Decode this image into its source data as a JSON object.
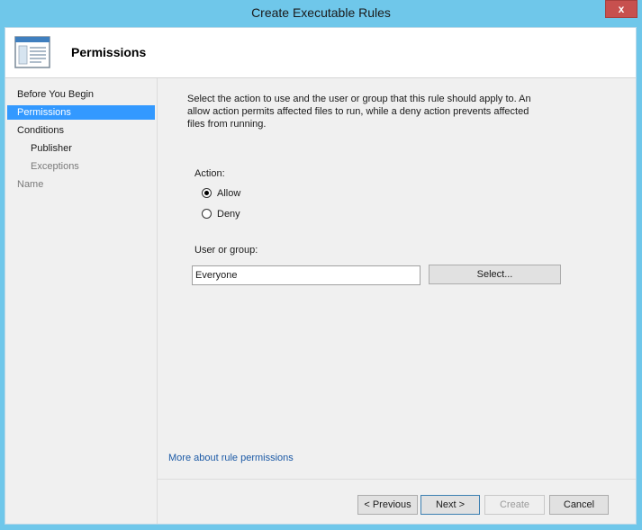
{
  "window": {
    "title": "Create Executable Rules",
    "close_glyph": "x"
  },
  "header": {
    "title": "Permissions",
    "icon": "wizard-page-icon"
  },
  "nav": {
    "items": [
      {
        "label": "Before You Begin",
        "state": "normal"
      },
      {
        "label": "Permissions",
        "state": "active"
      },
      {
        "label": "Conditions",
        "state": "normal"
      },
      {
        "label": "Publisher",
        "state": "normal"
      },
      {
        "label": "Exceptions",
        "state": "dim"
      },
      {
        "label": "Name",
        "state": "dim"
      }
    ]
  },
  "content": {
    "description": "Select the action to use and the user or group that this rule should apply to. An allow action permits affected files to run, while a deny action prevents affected files from running.",
    "action_label": "Action:",
    "allow_label": "Allow",
    "deny_label": "Deny",
    "selected_action": "Allow",
    "user_group_label": "User or group:",
    "user_group_value": "Everyone",
    "select_button": "Select...",
    "more_link": "More about rule permissions"
  },
  "footer": {
    "previous": "< Previous",
    "next": "Next >",
    "create": "Create",
    "cancel": "Cancel"
  },
  "colors": {
    "titlebar": "#6fc7ea",
    "selection": "#3399ff",
    "close": "#c7504e",
    "link": "#1c5aa6"
  }
}
